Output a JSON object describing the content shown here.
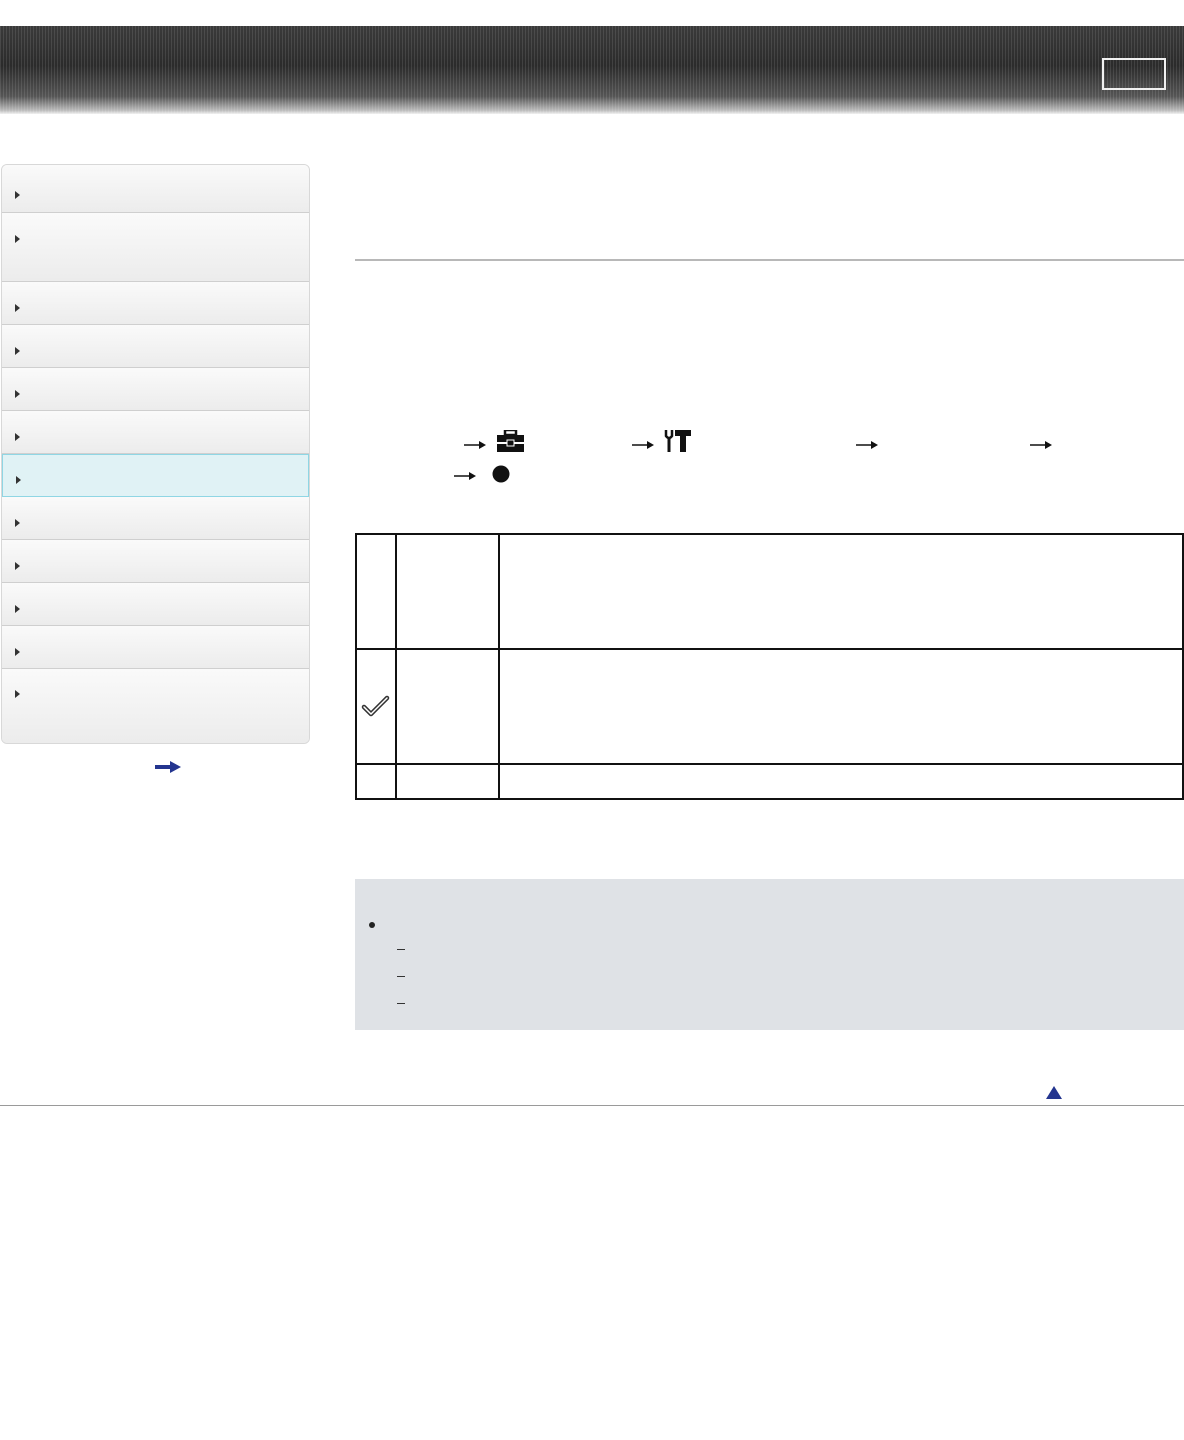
{
  "header": {
    "title": "",
    "button_label": ""
  },
  "sidebar": {
    "items": [
      {
        "label": ""
      },
      {
        "label": ""
      },
      {
        "label": ""
      },
      {
        "label": ""
      },
      {
        "label": ""
      },
      {
        "label": ""
      },
      {
        "label": ""
      },
      {
        "label": ""
      },
      {
        "label": ""
      },
      {
        "label": ""
      },
      {
        "label": ""
      },
      {
        "label": ""
      }
    ],
    "active_index": 6,
    "more_link_label": ""
  },
  "main": {
    "page_title": "",
    "intro": "",
    "procedure": {
      "steps": [
        "",
        "",
        "",
        "",
        "",
        ""
      ],
      "icons": [
        "toolbox-icon",
        "setup-wrench-icon",
        "filled-circle-icon"
      ]
    },
    "options": [
      {
        "icon": "",
        "name": "",
        "description": ""
      },
      {
        "icon": "checkmark-icon",
        "name": "",
        "description": ""
      },
      {
        "icon": "",
        "name": "",
        "description": ""
      }
    ]
  },
  "note": {
    "heading": "",
    "items": [
      "",
      "",
      ""
    ]
  },
  "footer": {
    "page_top_label": ""
  },
  "colors": {
    "header_dark": "#2b2b2b",
    "active_nav_bg": "#e0f2f5",
    "active_nav_border": "#8fd6e4",
    "note_bg": "#dfe2e6",
    "link_blue": "#24358f"
  }
}
